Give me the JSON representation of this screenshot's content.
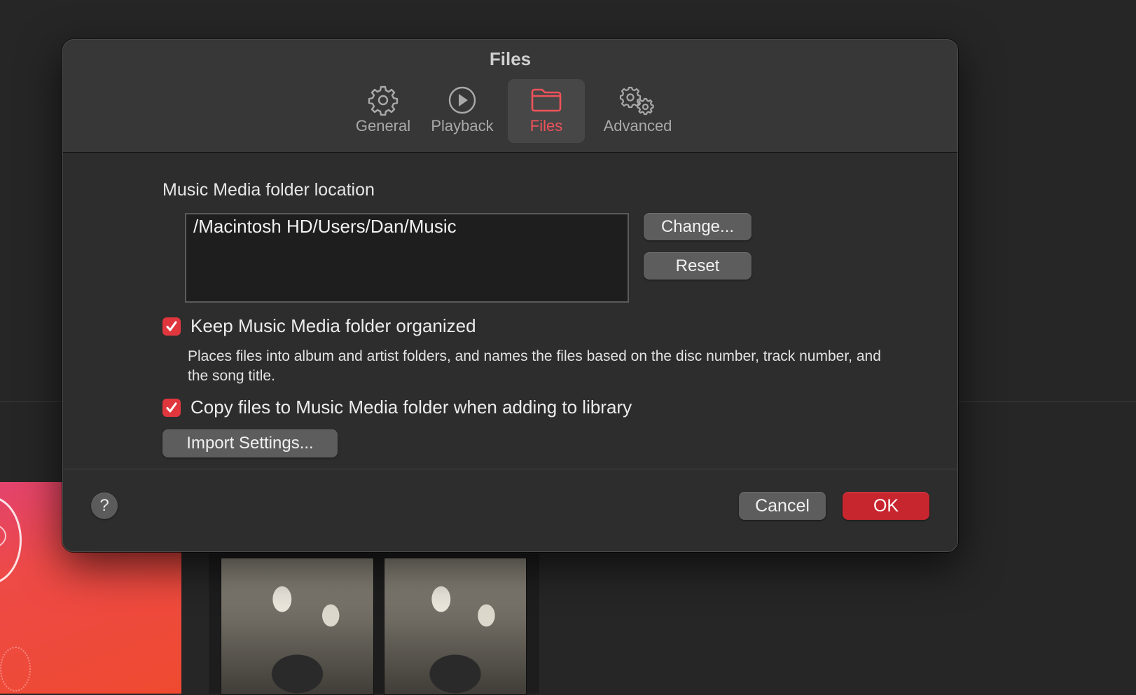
{
  "window": {
    "title": "Files"
  },
  "tabs": [
    {
      "label": "General",
      "icon": "gear-icon",
      "active": false
    },
    {
      "label": "Playback",
      "icon": "play-circle-icon",
      "active": false
    },
    {
      "label": "Files",
      "icon": "folder-icon",
      "active": true
    },
    {
      "label": "Advanced",
      "icon": "gears-icon",
      "active": false
    }
  ],
  "files": {
    "section_label": "Music Media folder location",
    "folder_path": "/Macintosh HD/Users/Dan/Music",
    "change_label": "Change...",
    "reset_label": "Reset",
    "keep_organized": {
      "label": "Keep Music Media folder organized",
      "checked": true,
      "description": "Places files into album and artist folders, and names the files based on the disc number, track number, and the song title."
    },
    "copy_files": {
      "label": "Copy files to Music Media folder when adding to library",
      "checked": true
    },
    "import_settings_label": "Import Settings..."
  },
  "footer": {
    "help_label": "?",
    "cancel_label": "Cancel",
    "ok_label": "OK"
  },
  "colors": {
    "accent": "#e0373f",
    "ok_button": "#c8262f",
    "active_tab_text": "#f0525a",
    "dialog_bg": "#2d2d2d"
  }
}
